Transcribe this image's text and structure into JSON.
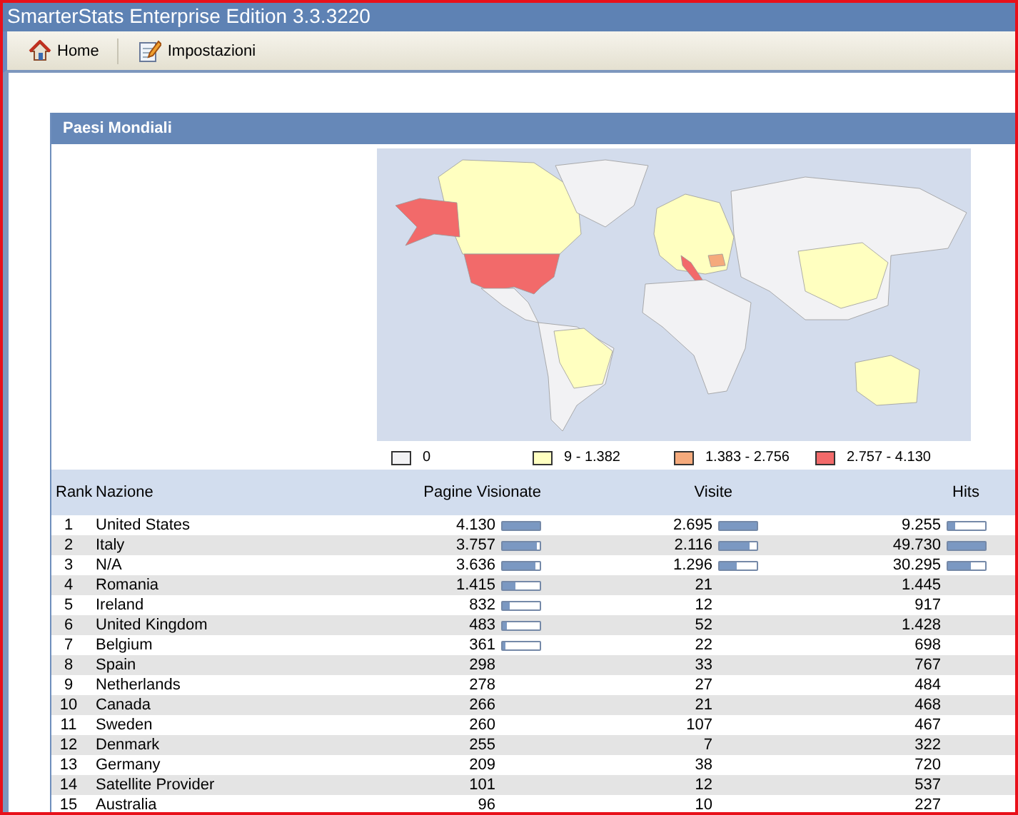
{
  "window": {
    "title": "SmarterStats Enterprise Edition 3.3.3220"
  },
  "toolbar": [
    {
      "label": "Home",
      "kind": "home"
    },
    {
      "label": "Impostazioni",
      "kind": "settings"
    }
  ],
  "panel": {
    "title": "Paesi Mondiali",
    "legend": [
      {
        "label": "0",
        "color": "#f2f2f4"
      },
      {
        "label": "9 - 1.382",
        "color": "#ffffc0"
      },
      {
        "label": "1.383 - 2.756",
        "color": "#f5aa7c"
      },
      {
        "label": "2.757 - 4.130",
        "color": "#f26a6a"
      }
    ],
    "table": {
      "columns": [
        "Rank",
        "Nazione",
        "Pagine Visionate",
        "Visite",
        "Hits"
      ],
      "rows": [
        {
          "rank": "1",
          "country": "United States",
          "pages": {
            "value": "4.130",
            "level": 1
          },
          "visits": {
            "value": "2.695",
            "level": 1
          },
          "hits": {
            "value": "9.255",
            "level": 0.19
          }
        },
        {
          "rank": "2",
          "country": "Italy",
          "pages": {
            "value": "3.757",
            "level": 0.91
          },
          "visits": {
            "value": "2.116",
            "level": 0.79
          },
          "hits": {
            "value": "49.730",
            "level": 1
          }
        },
        {
          "rank": "3",
          "country": "N/A",
          "pages": {
            "value": "3.636",
            "level": 0.88
          },
          "visits": {
            "value": "1.296",
            "level": 0.48
          },
          "hits": {
            "value": "30.295",
            "level": 0.61
          }
        },
        {
          "rank": "4",
          "country": "Romania",
          "pages": {
            "value": "1.415",
            "level": 0.34
          },
          "visits": {
            "value": "21"
          },
          "hits": {
            "value": "1.445"
          }
        },
        {
          "rank": "5",
          "country": "Ireland",
          "pages": {
            "value": "832",
            "level": 0.2
          },
          "visits": {
            "value": "12"
          },
          "hits": {
            "value": "917"
          }
        },
        {
          "rank": "6",
          "country": "United Kingdom",
          "pages": {
            "value": "483",
            "level": 0.12
          },
          "visits": {
            "value": "52"
          },
          "hits": {
            "value": "1.428"
          }
        },
        {
          "rank": "7",
          "country": "Belgium",
          "pages": {
            "value": "361",
            "level": 0.09
          },
          "visits": {
            "value": "22"
          },
          "hits": {
            "value": "698"
          }
        },
        {
          "rank": "8",
          "country": "Spain",
          "pages": {
            "value": "298"
          },
          "visits": {
            "value": "33"
          },
          "hits": {
            "value": "767"
          }
        },
        {
          "rank": "9",
          "country": "Netherlands",
          "pages": {
            "value": "278"
          },
          "visits": {
            "value": "27"
          },
          "hits": {
            "value": "484"
          }
        },
        {
          "rank": "10",
          "country": "Canada",
          "pages": {
            "value": "266"
          },
          "visits": {
            "value": "21"
          },
          "hits": {
            "value": "468"
          }
        },
        {
          "rank": "11",
          "country": "Sweden",
          "pages": {
            "value": "260"
          },
          "visits": {
            "value": "107"
          },
          "hits": {
            "value": "467"
          }
        },
        {
          "rank": "12",
          "country": "Denmark",
          "pages": {
            "value": "255"
          },
          "visits": {
            "value": "7"
          },
          "hits": {
            "value": "322"
          }
        },
        {
          "rank": "13",
          "country": "Germany",
          "pages": {
            "value": "209"
          },
          "visits": {
            "value": "38"
          },
          "hits": {
            "value": "720"
          }
        },
        {
          "rank": "14",
          "country": "Satellite Provider",
          "pages": {
            "value": "101"
          },
          "visits": {
            "value": "12"
          },
          "hits": {
            "value": "537"
          }
        },
        {
          "rank": "15",
          "country": "Australia",
          "pages": {
            "value": "96"
          },
          "visits": {
            "value": "10"
          },
          "hits": {
            "value": "227"
          }
        }
      ]
    }
  }
}
